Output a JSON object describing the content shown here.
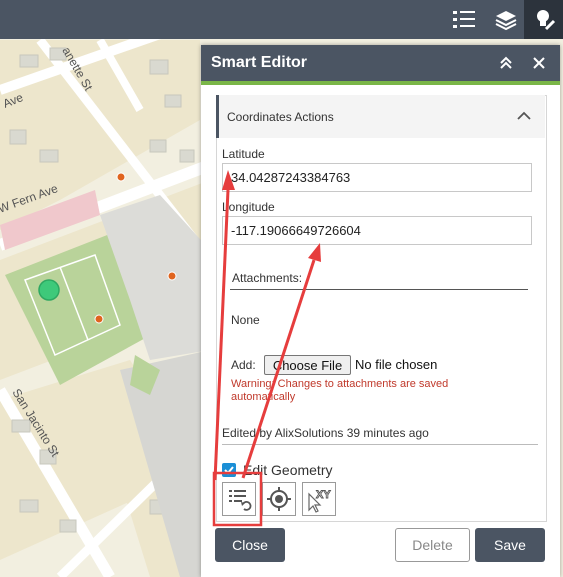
{
  "map": {
    "street_labels": [
      "Ave",
      "W Fern Ave",
      "San Jacinto St",
      "anette St"
    ]
  },
  "toolbar": {
    "icons": [
      "list-icon",
      "layers-icon",
      "smart-editor-icon"
    ]
  },
  "editor": {
    "title": "Smart Editor",
    "section_title": "Coordinates Actions",
    "latitude_label": "Latitude",
    "latitude_value": "34.04287243384763",
    "longitude_label": "Longitude",
    "longitude_value": "-117.19066649726604",
    "attachments_label": "Attachments:",
    "attachments_none": "None",
    "add_label": "Add:",
    "choose_file_label": "Choose File",
    "no_file_text": "No file chosen",
    "warning_line1": "Warning: Changes to attachments are saved",
    "warning_line2": "automatically",
    "edited_by": "Edited by AlixSolutions 39 minutes ago",
    "edit_geometry_label": "Edit Geometry",
    "close_label": "Close",
    "delete_label": "Delete",
    "save_label": "Save",
    "xy_tool_text": "XY"
  },
  "colors": {
    "header": "#4b5563",
    "accent_green": "#7ab648",
    "warning": "#c0392b",
    "annotation_red": "#e63d3d"
  }
}
